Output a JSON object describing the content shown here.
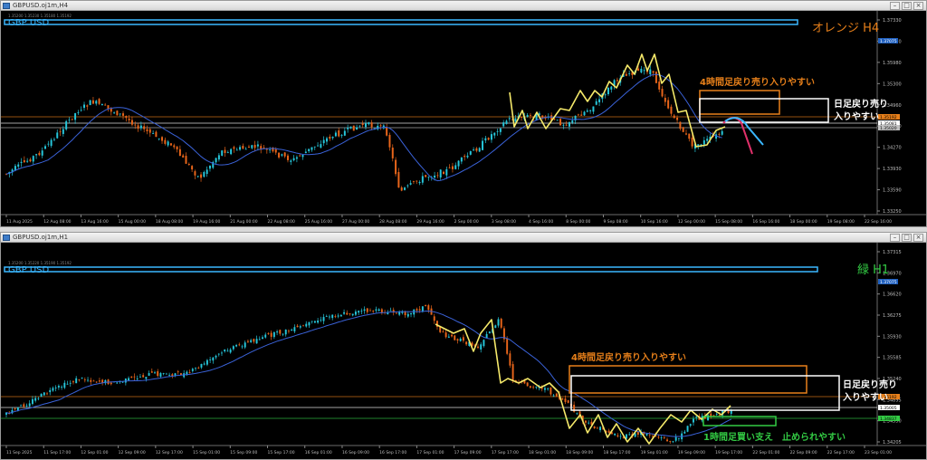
{
  "windows": [
    {
      "id": "top",
      "title": "GBPUSD.oj1m,H4",
      "ohlc_line": "1.35200 1.35230 1.35180 1.35192",
      "symbol": "GBP USD",
      "timeframe_label": "オレンジ H4",
      "price_ticks": [
        "1.37330",
        "1.36670",
        "1.35980",
        "1.35300",
        "1.34960",
        "1.34610",
        "1.34270",
        "1.33930",
        "1.33590",
        "1.33250"
      ],
      "current_prices": [
        {
          "value": "1.35192",
          "color": "#e8801a"
        },
        {
          "value": "1.35081",
          "color": "#ffffff"
        },
        {
          "value": "1.35020",
          "color": "#c0c0c0"
        }
      ],
      "top_price_box": "1.37075",
      "time_ticks": [
        "11 Aug 2025",
        "12 Aug 08:00",
        "13 Aug 16:00",
        "15 Aug 00:00",
        "18 Aug 08:00",
        "19 Aug 16:00",
        "21 Aug 00:00",
        "22 Aug 08:00",
        "25 Aug 16:00",
        "27 Aug 00:00",
        "28 Aug 08:00",
        "29 Aug 16:00",
        "2 Sep 00:00",
        "3 Sep 08:00",
        "4 Sep 16:00",
        "8 Sep 00:00",
        "9 Sep 08:00",
        "10 Sep 16:00",
        "12 Sep 00:00",
        "15 Sep 08:00",
        "16 Sep 16:00",
        "18 Sep 00:00",
        "19 Sep 08:00",
        "22 Sep 16:00"
      ],
      "annotations": {
        "orange_box_label": "4時間足戻り売り入りやすい",
        "white_box_label_line1": "日足戻り売り",
        "white_box_label_line2": "入りやすい"
      }
    },
    {
      "id": "bottom",
      "title": "GBPUSD.oj1m,H1",
      "ohlc_line": "1.35200 1.35220 1.35190 1.35192",
      "symbol": "GBP USD",
      "timeframe_label": "緑 H1",
      "price_ticks": [
        "1.37315",
        "1.36970",
        "1.36620",
        "1.36275",
        "1.35930",
        "1.35585",
        "1.35240",
        "1.34895",
        "1.34550",
        "1.34205"
      ],
      "current_prices": [
        {
          "value": "1.35192",
          "color": "#e8801a"
        },
        {
          "value": "1.35005",
          "color": "#ffffff"
        },
        {
          "value": "1.34837",
          "color": "#33cc44"
        }
      ],
      "top_price_box": "1.37075",
      "time_ticks": [
        "11 Sep 2025",
        "11 Sep 17:00",
        "12 Sep 01:00",
        "12 Sep 09:00",
        "12 Sep 17:00",
        "15 Sep 01:00",
        "15 Sep 09:00",
        "15 Sep 17:00",
        "16 Sep 01:00",
        "16 Sep 09:00",
        "16 Sep 17:00",
        "17 Sep 01:00",
        "17 Sep 09:00",
        "17 Sep 17:00",
        "18 Sep 01:00",
        "18 Sep 09:00",
        "18 Sep 17:00",
        "19 Sep 01:00",
        "19 Sep 09:00",
        "19 Sep 17:00",
        "22 Sep 01:00",
        "22 Sep 09:00",
        "22 Sep 17:00",
        "23 Sep 01:00"
      ],
      "annotations": {
        "orange_box_label": "4時間足戻り売り入りやすい",
        "white_box_label_line1": "日足戻り売り",
        "white_box_label_line2": "入りやすい",
        "green_box_label": "1時間足買い支え　止められやすい"
      }
    }
  ],
  "colors": {
    "bull": "#26c6da",
    "bear": "#e8651a",
    "ma": "#3a62d8",
    "zigzag": "#f5e96a",
    "orange": "#e8801a",
    "green": "#33cc44",
    "pink": "#e0306a",
    "cyan": "#3ab7ff"
  }
}
